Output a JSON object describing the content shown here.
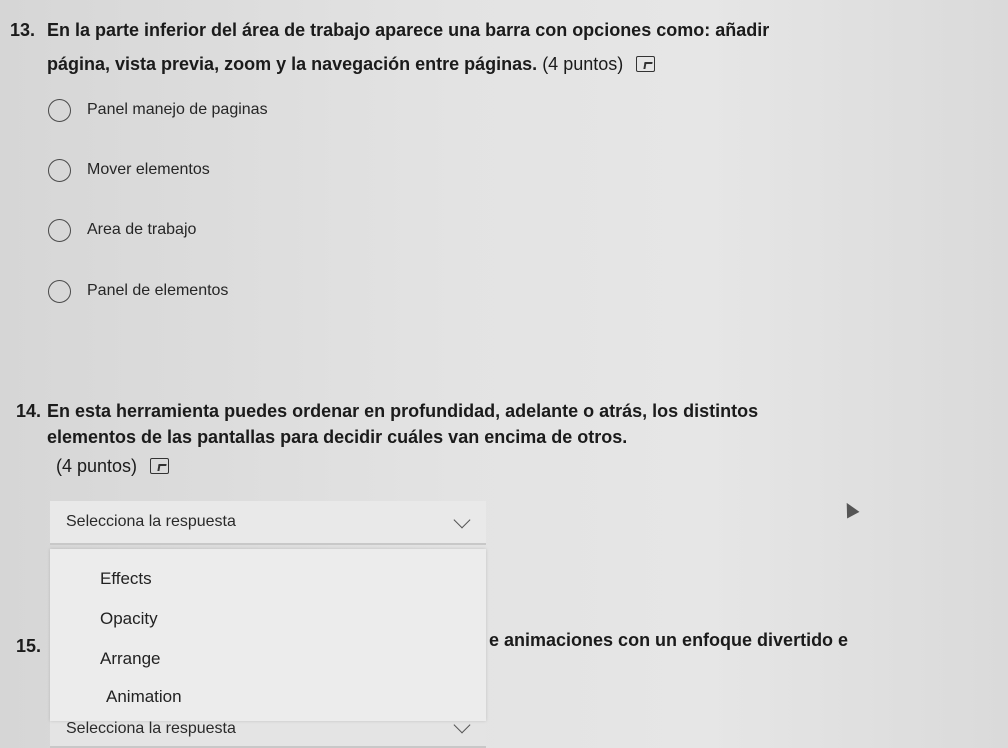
{
  "q13": {
    "number": "13.",
    "line1": "En la parte inferior del área de trabajo aparece una barra con opciones como: añadir",
    "line2": "página, vista previa, zoom y la navegación entre páginas.",
    "points": "(4 puntos)",
    "options": [
      "Panel manejo de paginas",
      "Mover elementos",
      "Area de trabajo",
      "Panel de elementos"
    ]
  },
  "q14": {
    "number": "14.",
    "line1": "En esta herramienta puedes ordenar en profundidad, adelante o atrás, los distintos",
    "line2": "elementos de las pantallas para decidir cuáles van encima de otros.",
    "points": "(4 puntos)",
    "select_placeholder": "Selecciona la respuesta",
    "dropdown_options": [
      "Effects",
      "Opacity",
      "Arrange",
      "Animation"
    ]
  },
  "q15": {
    "number": "15.",
    "text_fragment": "e animaciones con un enfoque divertido e",
    "select_placeholder": "Selecciona la respuesta"
  },
  "icons": {
    "speaker": "audio-read-aloud-icon",
    "chevron": "chevron-down-icon",
    "cursor": "mouse-pointer-icon"
  }
}
